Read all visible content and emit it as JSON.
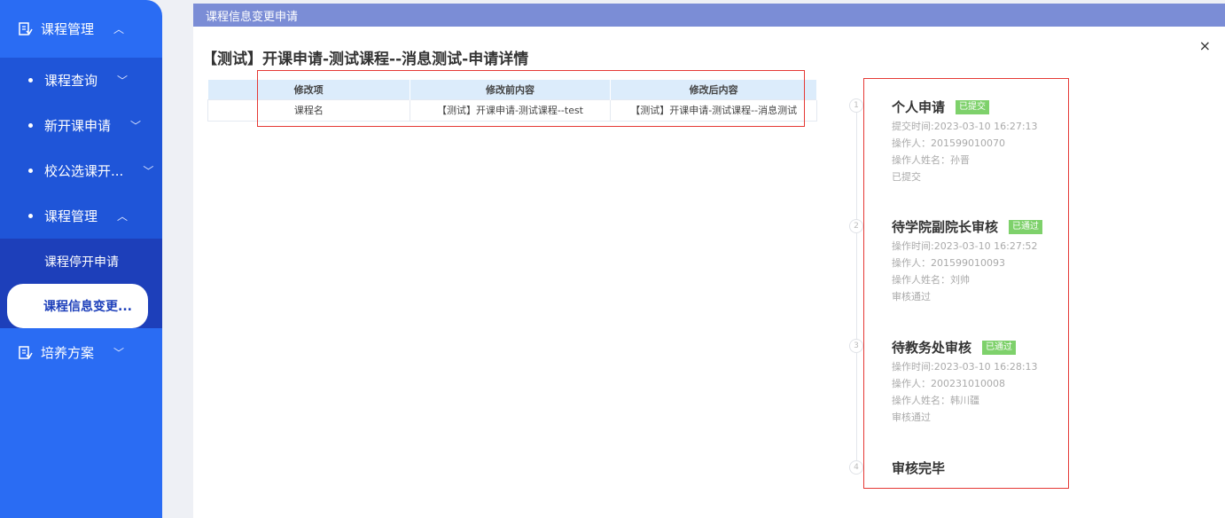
{
  "sidebar": {
    "top": {
      "label": "课程管理",
      "chevron": "^"
    },
    "subs": [
      {
        "label": "课程查询",
        "chevron": "v"
      },
      {
        "label": "新开课申请",
        "chevron": "v"
      },
      {
        "label": "校公选课开...",
        "chevron": "v"
      },
      {
        "label": "课程管理",
        "chevron": "^"
      }
    ],
    "subsubs": [
      {
        "label": "课程停开申请"
      },
      {
        "label": "课程信息变更..."
      }
    ],
    "bottom": {
      "label": "培养方案",
      "chevron": "v"
    }
  },
  "panel": {
    "header": "课程信息变更申请",
    "close": "×",
    "title": "【测试】开课申请-测试课程--消息测试-申请详情"
  },
  "table": {
    "headers": [
      "修改项",
      "修改前内容",
      "修改后内容"
    ],
    "rows": [
      [
        "课程名",
        "【测试】开课申请-测试课程--test",
        "【测试】开课申请-测试课程--消息测试"
      ]
    ]
  },
  "timeline": [
    {
      "num": "1",
      "name": "个人申请",
      "tag": "已提交",
      "time": "提交时间:2023-03-10 16:27:13",
      "operator": "操作人：201599010070",
      "operator_name": "操作人姓名：孙晋",
      "status": "已提交"
    },
    {
      "num": "2",
      "name": "待学院副院长审核",
      "tag": "已通过",
      "time": "操作时间:2023-03-10 16:27:52",
      "operator": "操作人：201599010093",
      "operator_name": "操作人姓名：刘帅",
      "status": "审核通过"
    },
    {
      "num": "3",
      "name": "待教务处审核",
      "tag": "已通过",
      "time": "操作时间:2023-03-10 16:28:13",
      "operator": "操作人：200231010008",
      "operator_name": "操作人姓名：韩川疆",
      "status": "审核通过"
    },
    {
      "num": "4",
      "name": "审核完毕"
    }
  ]
}
